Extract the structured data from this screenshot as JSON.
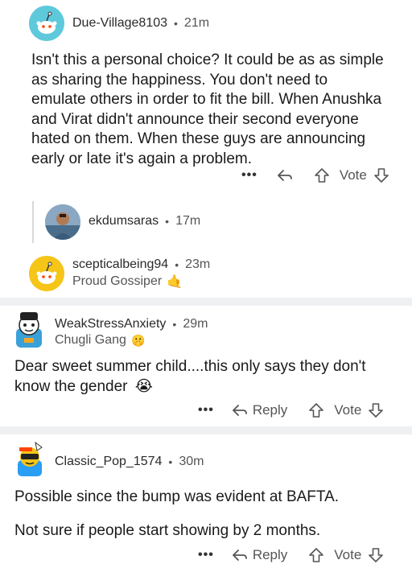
{
  "comments": [
    {
      "username": "Due-Village8103",
      "time": "21m",
      "body": "Isn't this a personal choice? It could be as as simple as sharing the happiness. You don't need to emulate others in order to fit the bill. When Anushka and Virat didn't announce their second everyone hated on them. When these guys are announcing early or late it's again a problem.",
      "vote_label": "Vote",
      "more_label": "•••"
    },
    {
      "username": "ekdumsaras",
      "time": "17m"
    },
    {
      "username": "scepticalbeing94",
      "time": "23m",
      "flair": "Proud Gossiper",
      "flair_emoji": "🤙"
    },
    {
      "username": "WeakStressAnxiety",
      "time": "29m",
      "flair": "Chugli Gang",
      "flair_emoji": "🤫",
      "body": "Dear sweet summer child....this only says they don't know the gender",
      "body_emoji": "😭",
      "reply_label": "Reply",
      "vote_label": "Vote",
      "more_label": "•••"
    },
    {
      "username": "Classic_Pop_1574",
      "time": "30m",
      "body_p1": "Possible since the bump was evident at BAFTA.",
      "body_p2": "Not sure if people start showing by 2 months.",
      "reply_label": "Reply",
      "vote_label": "Vote",
      "more_label": "•••"
    }
  ],
  "separator": "•",
  "colors": {
    "divider": "#eef0f2",
    "avatar_teal": "#4fc3d9",
    "avatar_yellow": "#f5c518",
    "meta_gray": "#555555"
  }
}
